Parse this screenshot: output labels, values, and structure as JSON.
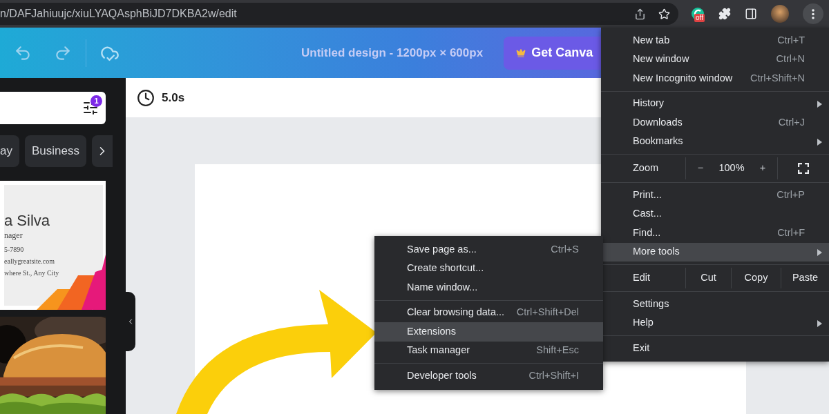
{
  "address_bar": {
    "url": "n/DAFJahiuujc/xiuLYAQAsphBiJD7DKBA2w/edit"
  },
  "extension_badge": "off",
  "editor_header": {
    "title": "Untitled design - 1200px × 600px",
    "upgrade_button": "Get Canva"
  },
  "side_panel": {
    "filter_badge": "1",
    "category_chips": [
      "ay",
      "Business"
    ],
    "template_card": {
      "lines": [
        "a Silva",
        "nager",
        "5-7890",
        "eallygreatsite.com",
        "where St., Any City"
      ]
    },
    "second_template": {
      "kind": "picture"
    }
  },
  "toolbar": {
    "duration": "5.0s"
  },
  "browser_menu": {
    "items": [
      {
        "kind": "item",
        "label": "New tab",
        "shortcut": "Ctrl+T",
        "has_submenu": false,
        "selected": false
      },
      {
        "kind": "item",
        "label": "New window",
        "shortcut": "Ctrl+N",
        "has_submenu": false,
        "selected": false
      },
      {
        "kind": "item",
        "label": "New Incognito window",
        "shortcut": "Ctrl+Shift+N",
        "has_submenu": false,
        "selected": false
      },
      {
        "kind": "divider"
      },
      {
        "kind": "item",
        "label": "History",
        "has_submenu": true,
        "selected": false
      },
      {
        "kind": "item",
        "label": "Downloads",
        "shortcut": "Ctrl+J",
        "has_submenu": false,
        "selected": false
      },
      {
        "kind": "item",
        "label": "Bookmarks",
        "has_submenu": true,
        "selected": false
      },
      {
        "kind": "divider"
      },
      {
        "kind": "zoom",
        "label": "Zoom",
        "minus": "−",
        "value": "100%",
        "plus": "+"
      },
      {
        "kind": "divider"
      },
      {
        "kind": "item",
        "label": "Print...",
        "shortcut": "Ctrl+P",
        "has_submenu": false,
        "selected": false
      },
      {
        "kind": "item",
        "label": "Cast...",
        "has_submenu": false,
        "selected": false
      },
      {
        "kind": "item",
        "label": "Find...",
        "shortcut": "Ctrl+F",
        "has_submenu": false,
        "selected": false
      },
      {
        "kind": "item",
        "label": "More tools",
        "has_submenu": true,
        "selected": true
      },
      {
        "kind": "divider"
      },
      {
        "kind": "edit",
        "label": "Edit",
        "actions": [
          "Cut",
          "Copy",
          "Paste"
        ]
      },
      {
        "kind": "divider"
      },
      {
        "kind": "item",
        "label": "Settings",
        "has_submenu": false,
        "selected": false
      },
      {
        "kind": "item",
        "label": "Help",
        "has_submenu": true,
        "selected": false
      },
      {
        "kind": "divider"
      },
      {
        "kind": "item",
        "label": "Exit",
        "has_submenu": false,
        "selected": false
      }
    ]
  },
  "more_tools_submenu": {
    "items": [
      {
        "kind": "item",
        "label": "Save page as...",
        "shortcut": "Ctrl+S",
        "selected": false
      },
      {
        "kind": "item",
        "label": "Create shortcut...",
        "selected": false
      },
      {
        "kind": "item",
        "label": "Name window...",
        "selected": false
      },
      {
        "kind": "divider"
      },
      {
        "kind": "item",
        "label": "Clear browsing data...",
        "shortcut": "Ctrl+Shift+Del",
        "selected": false
      },
      {
        "kind": "item",
        "label": "Extensions",
        "selected": true
      },
      {
        "kind": "item",
        "label": "Task manager",
        "shortcut": "Shift+Esc",
        "selected": false
      },
      {
        "kind": "divider"
      },
      {
        "kind": "item",
        "label": "Developer tools",
        "shortcut": "Ctrl+Shift+I",
        "selected": false
      }
    ]
  }
}
